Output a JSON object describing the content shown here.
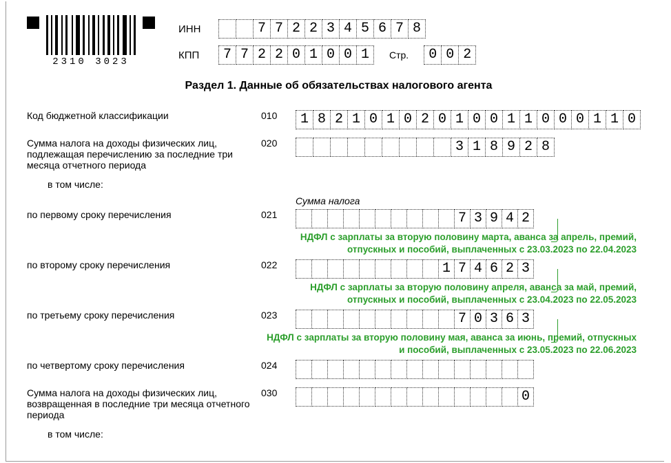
{
  "header": {
    "barcode_label": "2310 3023",
    "inn_label": "ИНН",
    "inn": "7722345678",
    "kpp_label": "КПП",
    "kpp": "772201001",
    "page_label": "Стр.",
    "page": "002"
  },
  "section_title": "Раздел 1. Данные об обязательствах налогового агента",
  "rows": {
    "kbk": {
      "label": "Код бюджетной классификации",
      "code": "010",
      "value": "18210102010011000110",
      "len": 20
    },
    "sum3m": {
      "label": "Сумма налога на доходы физических лиц, подлежащая перечислению за последние три месяца отчетного периода",
      "code": "020",
      "value": "318928",
      "len": 15
    },
    "subline": "в том числе:",
    "sumhdr": "Сумма налога",
    "s1": {
      "label": "по первому сроку перечисления",
      "code": "021",
      "value": "73942",
      "len": 15
    },
    "n1": "НДФЛ с зарплаты за вторую половину марта, аванса за апрель, премий, отпускных и пособий, выплаченных с 23.03.2023 по 22.04.2023",
    "s2": {
      "label": "по второму сроку перечисления",
      "code": "022",
      "value": "174623",
      "len": 15
    },
    "n2": "НДФЛ с зарплаты за вторую половину апреля, аванса за май, премий, отпускных и пособий, выплаченных с 23.04.2023 по 22.05.2023",
    "s3": {
      "label": "по третьему сроку перечисления",
      "code": "023",
      "value": "70363",
      "len": 15
    },
    "n3": "НДФЛ с зарплаты за вторую половину мая, аванса за июнь, премий, отпускных и пособий, выплаченных с 23.05.2023 по 22.06.2023",
    "s4": {
      "label": "по четвертому сроку перечисления",
      "code": "024",
      "value": "",
      "len": 15
    },
    "ret": {
      "label": "Сумма налога на доходы физических лиц, возвращенная в последние три месяца отчетного периода",
      "code": "030",
      "value": "0",
      "len": 15
    },
    "subline2": "в том числе:"
  }
}
